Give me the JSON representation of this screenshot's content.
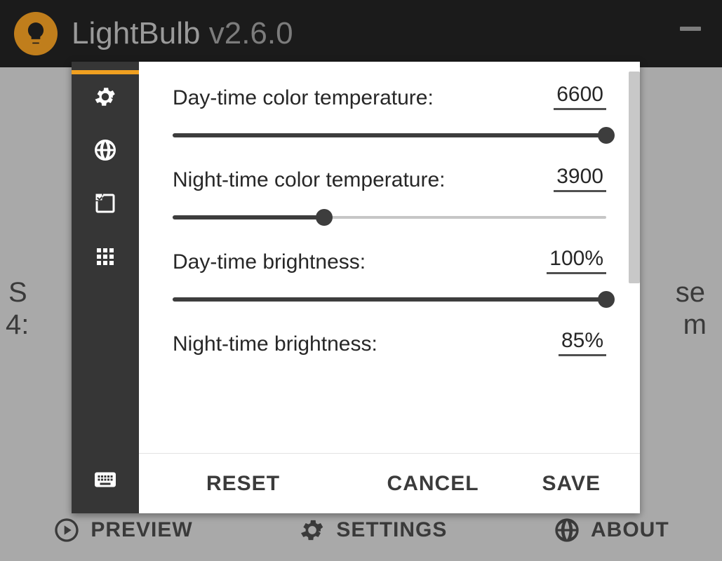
{
  "app": {
    "name": "LightBulb",
    "version": "v2.6.0"
  },
  "background": {
    "left1": "S",
    "left2": "4:",
    "right1": "se",
    "right2": "m"
  },
  "footer": {
    "preview": "PREVIEW",
    "settings": "SETTINGS",
    "about": "ABOUT"
  },
  "sidebar": {
    "items": [
      {
        "name": "general",
        "icon": "gear",
        "active": true
      },
      {
        "name": "location",
        "icon": "globe",
        "active": false
      },
      {
        "name": "rules",
        "icon": "check",
        "active": false
      },
      {
        "name": "grid",
        "icon": "grid",
        "active": false
      },
      {
        "name": "hotkeys",
        "icon": "keyboard",
        "active": false
      }
    ]
  },
  "settings": {
    "day_temp": {
      "label": "Day-time color temperature:",
      "value": "6600",
      "percent": 100
    },
    "night_temp": {
      "label": "Night-time color temperature:",
      "value": "3900",
      "percent": 35
    },
    "day_bright": {
      "label": "Day-time brightness:",
      "value": "100%",
      "percent": 100
    },
    "night_bright": {
      "label": "Night-time brightness:",
      "value": "85%",
      "percent": 85
    }
  },
  "actions": {
    "reset": "RESET",
    "cancel": "CANCEL",
    "save": "SAVE"
  }
}
